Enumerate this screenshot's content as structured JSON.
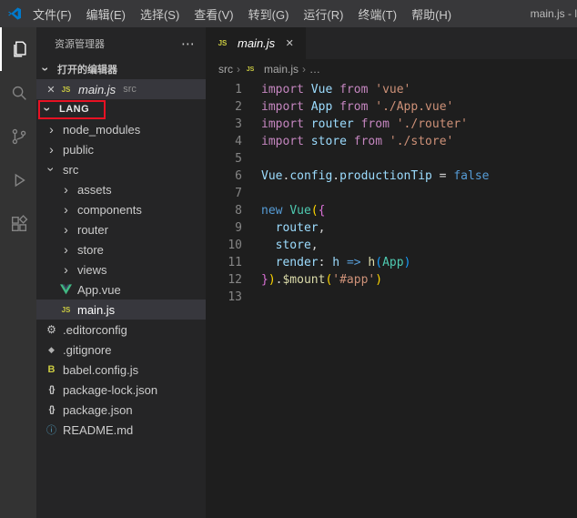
{
  "colors": {
    "accent_blue": "#007acc",
    "annotation_red": "#e81123",
    "selection_bg": "#37373d",
    "js_yellow": "#cbcb41",
    "vue_green": "#41b883"
  },
  "title_bar": {
    "menus": [
      "文件(F)",
      "编辑(E)",
      "选择(S)",
      "查看(V)",
      "转到(G)",
      "运行(R)",
      "终端(T)",
      "帮助(H)"
    ],
    "window_title": "main.js - l"
  },
  "activity_bar": {
    "items": [
      {
        "name": "explorer",
        "active": true
      },
      {
        "name": "search",
        "active": false
      },
      {
        "name": "source-control",
        "active": false
      },
      {
        "name": "run-debug",
        "active": false
      },
      {
        "name": "extensions",
        "active": false
      }
    ]
  },
  "sidebar": {
    "title": "资源管理器",
    "more_actions": "⋯",
    "open_editors": {
      "header": "打开的编辑器",
      "items": [
        {
          "name": "main.js",
          "detail": "src",
          "active": true
        }
      ]
    },
    "workspace": "LANG",
    "tree": [
      {
        "label": "node_modules",
        "icon": "chevron",
        "state": "collapsed",
        "indent": 0
      },
      {
        "label": "public",
        "icon": "chevron",
        "state": "collapsed",
        "indent": 0
      },
      {
        "label": "src",
        "icon": "chevron",
        "state": "expanded",
        "indent": 0
      },
      {
        "label": "assets",
        "icon": "chevron",
        "state": "collapsed",
        "indent": 1
      },
      {
        "label": "components",
        "icon": "chevron",
        "state": "collapsed",
        "indent": 1
      },
      {
        "label": "router",
        "icon": "chevron",
        "state": "collapsed",
        "indent": 1
      },
      {
        "label": "store",
        "icon": "chevron",
        "state": "collapsed",
        "indent": 1
      },
      {
        "label": "views",
        "icon": "chevron",
        "state": "collapsed",
        "indent": 1
      },
      {
        "label": "App.vue",
        "icon": "vue",
        "indent": 1
      },
      {
        "label": "main.js",
        "icon": "js",
        "indent": 1,
        "selected": true
      },
      {
        "label": ".editorconfig",
        "icon": "gear",
        "indent": 0
      },
      {
        "label": ".gitignore",
        "icon": "diamond",
        "indent": 0
      },
      {
        "label": "babel.config.js",
        "icon": "babel",
        "indent": 0
      },
      {
        "label": "package-lock.json",
        "icon": "braces",
        "indent": 0
      },
      {
        "label": "package.json",
        "icon": "braces",
        "indent": 0
      },
      {
        "label": "README.md",
        "icon": "info",
        "indent": 0
      }
    ]
  },
  "editor": {
    "tab": {
      "label": "main.js"
    },
    "breadcrumb": [
      "src",
      "main.js",
      "…"
    ],
    "code_lines": [
      {
        "n": 1,
        "tokens": [
          [
            "import",
            "kw"
          ],
          [
            " ",
            "pl"
          ],
          [
            "Vue",
            "var"
          ],
          [
            " ",
            "pl"
          ],
          [
            "from",
            "kw"
          ],
          [
            " ",
            "pl"
          ],
          [
            "'vue'",
            "str"
          ]
        ]
      },
      {
        "n": 2,
        "tokens": [
          [
            "import",
            "kw"
          ],
          [
            " ",
            "pl"
          ],
          [
            "App",
            "var"
          ],
          [
            " ",
            "pl"
          ],
          [
            "from",
            "kw"
          ],
          [
            " ",
            "pl"
          ],
          [
            "'./App.vue'",
            "str"
          ]
        ]
      },
      {
        "n": 3,
        "tokens": [
          [
            "import",
            "kw"
          ],
          [
            " ",
            "pl"
          ],
          [
            "router",
            "var"
          ],
          [
            " ",
            "pl"
          ],
          [
            "from",
            "kw"
          ],
          [
            " ",
            "pl"
          ],
          [
            "'./router'",
            "str"
          ]
        ]
      },
      {
        "n": 4,
        "tokens": [
          [
            "import",
            "kw"
          ],
          [
            " ",
            "pl"
          ],
          [
            "store",
            "var"
          ],
          [
            " ",
            "pl"
          ],
          [
            "from",
            "kw"
          ],
          [
            " ",
            "pl"
          ],
          [
            "'./store'",
            "str"
          ]
        ]
      },
      {
        "n": 5,
        "tokens": []
      },
      {
        "n": 6,
        "tokens": [
          [
            "Vue",
            "var"
          ],
          [
            ".",
            "pl"
          ],
          [
            "config",
            "var"
          ],
          [
            ".",
            "pl"
          ],
          [
            "productionTip",
            "var"
          ],
          [
            " = ",
            "pl"
          ],
          [
            "false",
            "kwb"
          ]
        ]
      },
      {
        "n": 7,
        "tokens": []
      },
      {
        "n": 8,
        "tokens": [
          [
            "new",
            "kwb"
          ],
          [
            " ",
            "pl"
          ],
          [
            "Vue",
            "cls"
          ],
          [
            "(",
            "b1"
          ],
          [
            "{",
            "b2"
          ]
        ]
      },
      {
        "n": 9,
        "tokens": [
          [
            "  ",
            "pl"
          ],
          [
            "router",
            "var"
          ],
          [
            ",",
            "pl"
          ]
        ]
      },
      {
        "n": 10,
        "tokens": [
          [
            "  ",
            "pl"
          ],
          [
            "store",
            "var"
          ],
          [
            ",",
            "pl"
          ]
        ]
      },
      {
        "n": 11,
        "tokens": [
          [
            "  ",
            "pl"
          ],
          [
            "render",
            "var"
          ],
          [
            ": ",
            "pl"
          ],
          [
            "h",
            "var"
          ],
          [
            " ",
            "pl"
          ],
          [
            "=>",
            "kwb"
          ],
          [
            " ",
            "pl"
          ],
          [
            "h",
            "fn"
          ],
          [
            "(",
            "b3"
          ],
          [
            "App",
            "cls"
          ],
          [
            ")",
            "b3"
          ]
        ]
      },
      {
        "n": 12,
        "tokens": [
          [
            "}",
            "b2"
          ],
          [
            ")",
            "b1"
          ],
          [
            ".",
            "pl"
          ],
          [
            "$mount",
            "fn"
          ],
          [
            "(",
            "b1"
          ],
          [
            "'#app'",
            "str"
          ],
          [
            ")",
            "b1"
          ]
        ]
      },
      {
        "n": 13,
        "tokens": []
      }
    ]
  }
}
